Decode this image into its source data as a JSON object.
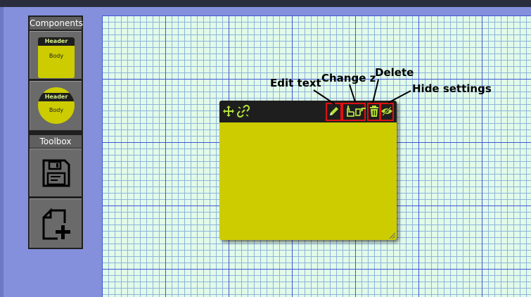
{
  "sidebar": {
    "components_title": "Components",
    "toolbox_title": "Toolbox",
    "rect_component": {
      "header": "Header",
      "body": "Body"
    },
    "circle_component": {
      "header": "Header",
      "body": "Body"
    },
    "tools": [
      "save-icon",
      "new-file-icon"
    ]
  },
  "note": {
    "header_icons_left": [
      "move-icon",
      "link-icon"
    ],
    "header_icons_right": [
      "pencil-icon",
      "hand-up-icon",
      "hand-down-icon",
      "trash-icon",
      "eye-off-icon"
    ]
  },
  "annotations": {
    "edit_text": "Edit text",
    "change_z": "Change z",
    "delete": "Delete",
    "hide_settings": "Hide settings"
  },
  "colors": {
    "accent": "#b4e03c",
    "note_body": "#cccc00",
    "highlight": "#e01010"
  }
}
